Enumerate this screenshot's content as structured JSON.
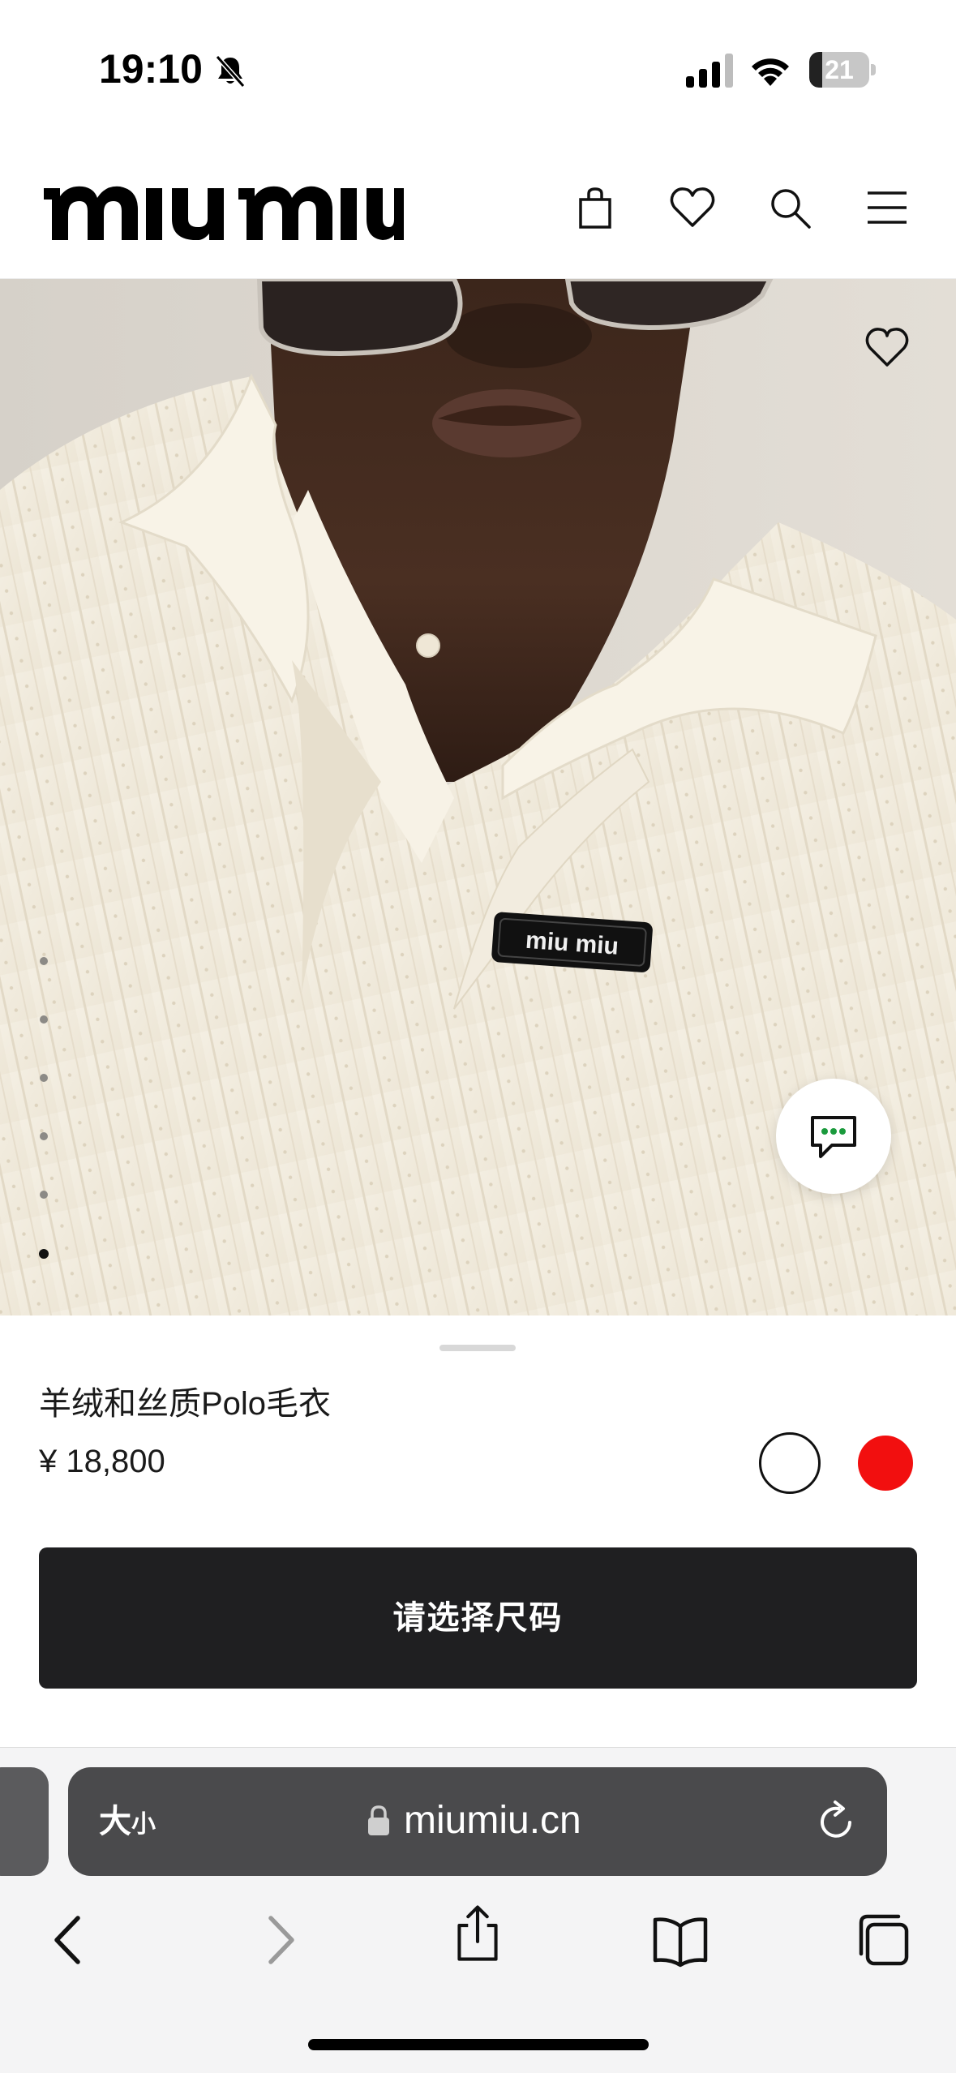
{
  "status_bar": {
    "time": "19:10",
    "battery_level": "21",
    "battery_fraction": 0.21,
    "icons": [
      "bell-slash-icon",
      "cellular-signal-icon",
      "wifi-icon",
      "battery-icon"
    ]
  },
  "header": {
    "brand": "miu miu",
    "icons": [
      "shopping-bag-icon",
      "heart-icon",
      "search-icon",
      "menu-icon"
    ]
  },
  "gallery": {
    "image_count": 6,
    "active_index": 5,
    "patch_text": "miu miu",
    "favorite_icon": "heart-icon",
    "chat_icon": "chat-bubble-icon"
  },
  "product": {
    "name": "羊绒和丝质Polo毛衣",
    "price": "¥ 18,800",
    "colors": [
      {
        "name": "white",
        "hex": "#ffffff",
        "selected": true
      },
      {
        "name": "red",
        "hex": "#f20f0f",
        "selected": false
      }
    ],
    "cta_label": "请选择尺码"
  },
  "browser": {
    "text_size_label_large": "大",
    "text_size_label_small": "小",
    "url": "miumiu.cn",
    "toolbar_icons": [
      "back-icon",
      "forward-icon",
      "share-icon",
      "bookmarks-icon",
      "tabs-icon"
    ],
    "accent": "#4a4a4c"
  }
}
